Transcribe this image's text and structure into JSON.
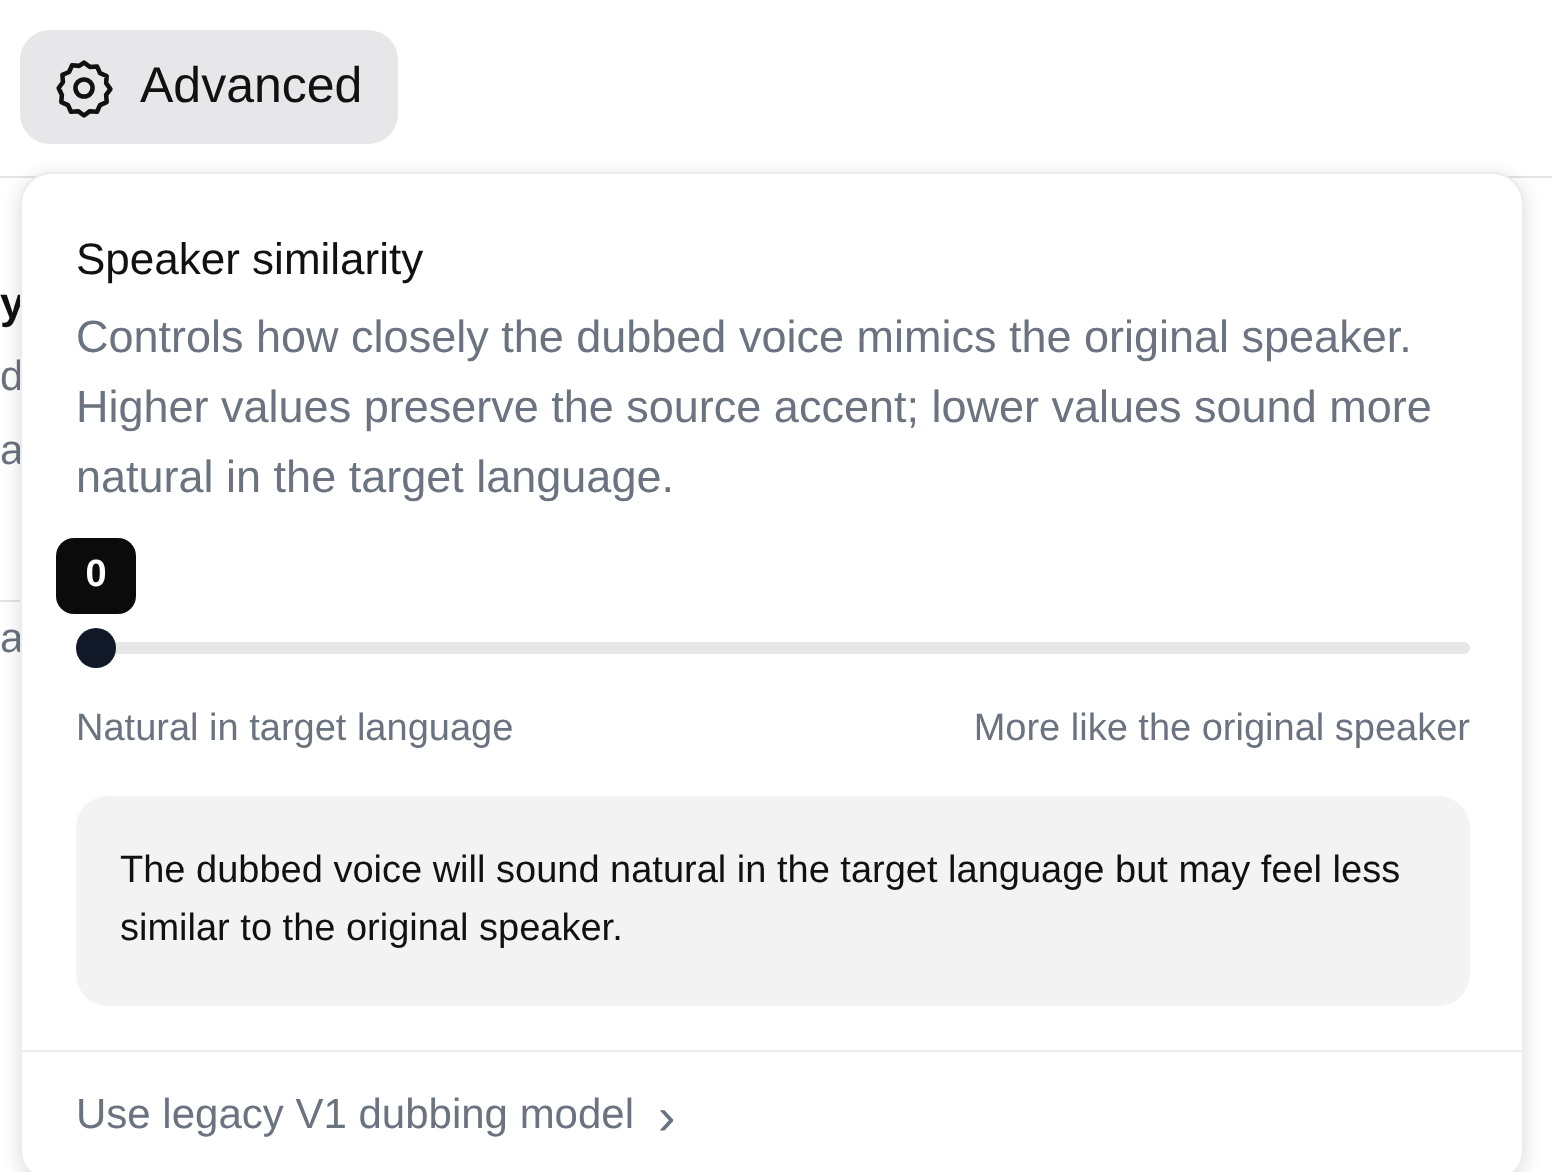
{
  "advanced_button": {
    "label": "Advanced"
  },
  "background_fragments": [
    {
      "text": "y",
      "kind": "heading"
    },
    {
      "text": "d",
      "kind": "body"
    },
    {
      "text": "a",
      "kind": "body"
    },
    {
      "text": "a",
      "kind": "body"
    }
  ],
  "popover": {
    "title": "Speaker similarity",
    "description": "Controls how closely the dubbed voice mimics the original speaker. Higher values preserve the source accent; lower values sound more natural in the target language.",
    "slider": {
      "level": 0,
      "tooltip": "0",
      "min_label": "Natural in target language",
      "max_label": "More like the original speaker"
    },
    "info": "The dubbed voice will sound natural in the target language but may feel less similar to the original speaker.",
    "footer_link": "Use legacy V1 dubbing model",
    "footer_chevron": "›"
  }
}
